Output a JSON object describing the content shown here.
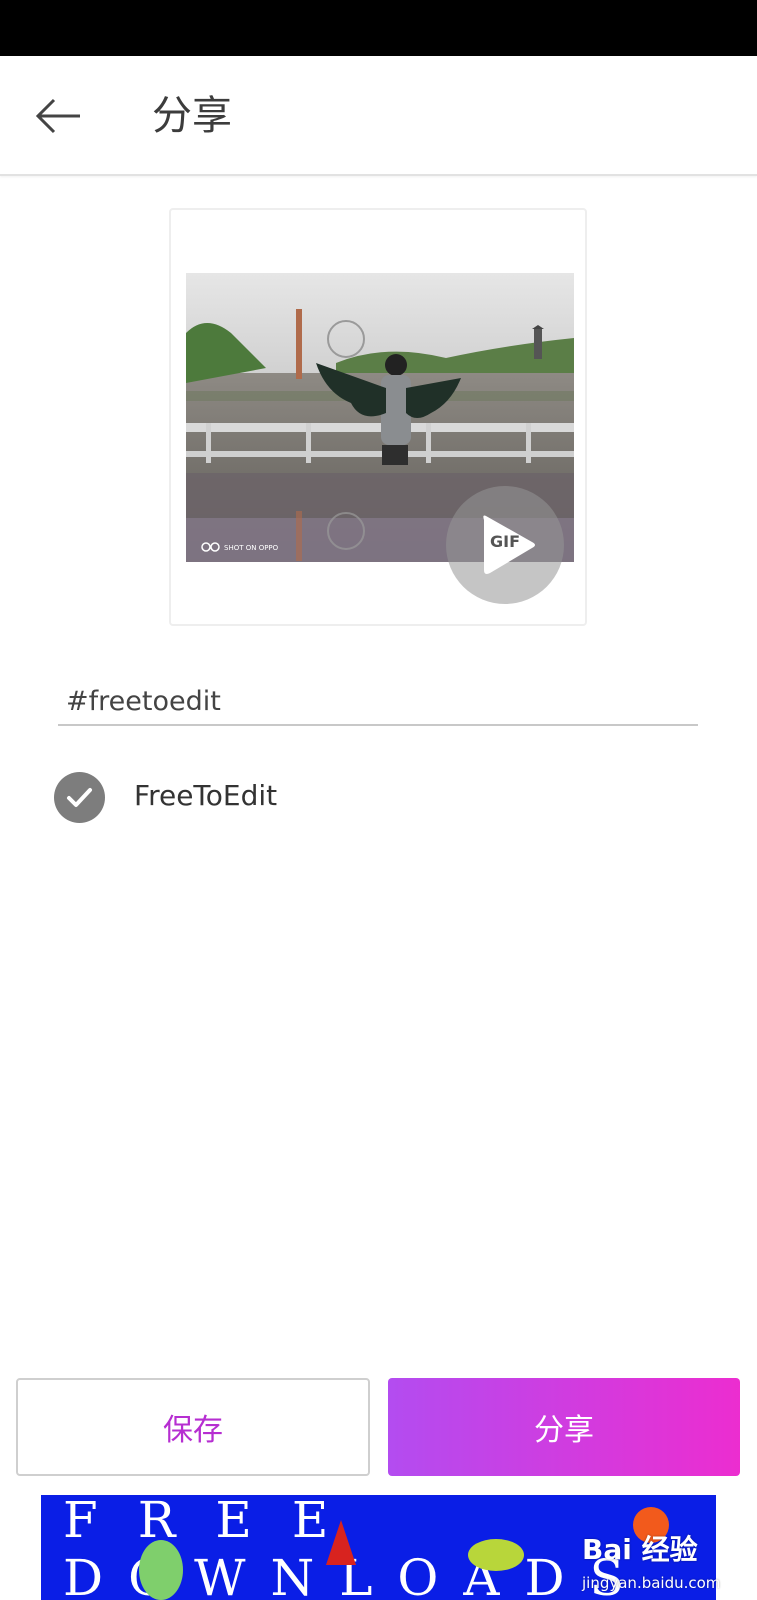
{
  "header": {
    "title": "分享"
  },
  "preview": {
    "gif_label": "GIF",
    "watermark_text": "SHOT ON OPPO"
  },
  "caption": {
    "value": "#freetoedit"
  },
  "free_to_edit": {
    "label": "FreeToEdit",
    "checked": true
  },
  "actions": {
    "save_label": "保存",
    "share_label": "分享"
  },
  "ad": {
    "line1": "FREE",
    "line2": "DOWNLOADS"
  },
  "watermark": {
    "brand": "Bai 经验",
    "url": "jingyan.baidu.com"
  },
  "colors": {
    "accent": "#b62ed1",
    "share_gradient_start": "#b34cf0",
    "share_gradient_end": "#ec2dd0",
    "ad_blue": "#0a1ee6"
  }
}
